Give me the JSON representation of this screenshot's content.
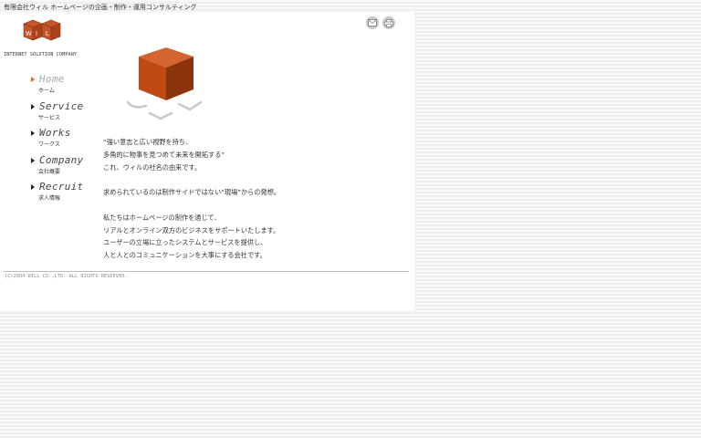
{
  "header": {
    "tagline": "有限会社ウィル ホームページの企画・制作・運用コンサルティング"
  },
  "logo": {
    "letters": [
      "W",
      "I",
      "L"
    ],
    "subtitle": "INTERNET SOLUTION COMPANY",
    "color": "#c4542a"
  },
  "utility": {
    "mail_icon": "mail-icon",
    "print_icon": "print-icon"
  },
  "nav": [
    {
      "en": "Home",
      "jp": "ホーム",
      "active": true
    },
    {
      "en": "Service",
      "jp": "サービス"
    },
    {
      "en": "Works",
      "jp": "ワークス"
    },
    {
      "en": "Company",
      "jp": "会社概要"
    },
    {
      "en": "Recruit",
      "jp": "求人情報"
    }
  ],
  "hero": {
    "cube_colors": {
      "top": "#d5652e",
      "left": "#c04a14",
      "right": "#8a330c"
    }
  },
  "body": {
    "para1": [
      "“強い意志と広い視野を持ち、",
      "多角的に物事を見つめて未来を開拓する”",
      "これ、ウィルの社名の由来です。"
    ],
    "para2": [
      "求められているのは制作サイドではない“現場”からの発想。"
    ],
    "para3": [
      "私たちはホームページの制作を通じて、",
      "リアルとオンライン双方のビジネスをサポートいたします。",
      "ユーザーの立場に立ったシステムとサービスを提供し、",
      "人と人とのコミュニケーションを大事にする会社です。"
    ]
  },
  "footer": {
    "copyright": "(C)2004 WILL CO.,LTD. ALL RIGHTS RESERVED."
  },
  "colors": {
    "accent": "#e0692b",
    "background": "#f1f1f1"
  }
}
